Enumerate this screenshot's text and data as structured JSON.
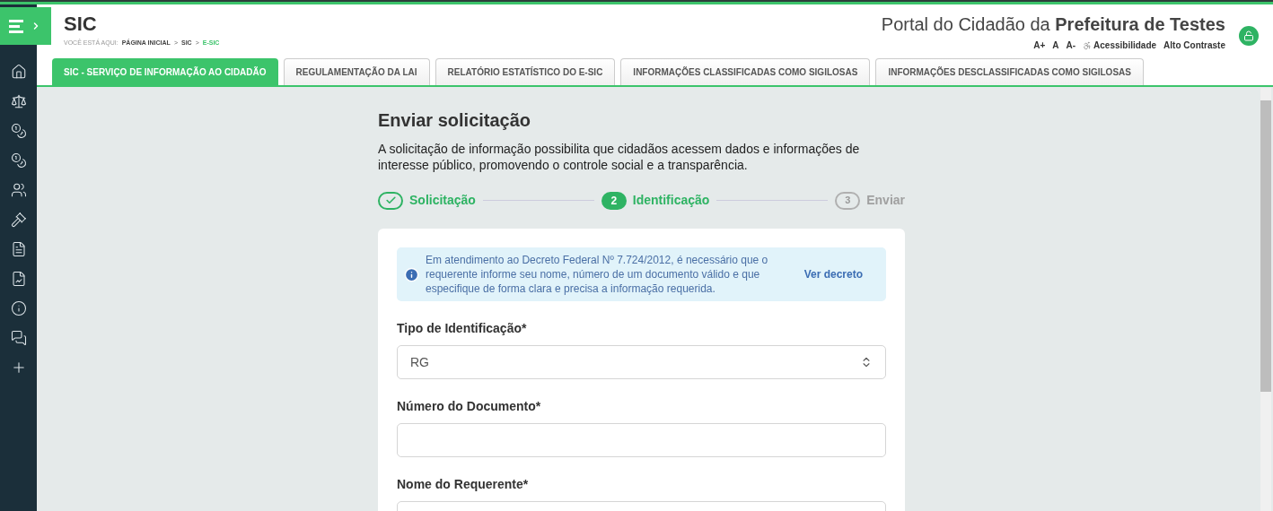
{
  "header": {
    "title": "SIC",
    "breadcrumb_label": "VOCÊ ESTÁ AQUI:",
    "breadcrumb": [
      {
        "label": "PÁGINA INICIAL",
        "selected": false
      },
      {
        "label": "SIC",
        "selected": false
      },
      {
        "label": "E-SIC",
        "selected": true
      }
    ],
    "breadcrumb_separator": ">",
    "portal_prefix": "Portal do Cidadão da",
    "portal_name": "Prefeitura de Testes",
    "accessibility": [
      "A+",
      "A",
      "A-"
    ],
    "accessibility_label": "Acessibilidade",
    "contrast_label": "Alto Contraste"
  },
  "tabs": [
    {
      "label": "SIC - SERVIÇO DE INFORMAÇÃO AO CIDADÃO",
      "selected": true
    },
    {
      "label": "REGULAMENTAÇÃO DA LAI",
      "selected": false
    },
    {
      "label": "RELATÓRIO ESTATÍSTICO DO E-SIC",
      "selected": false
    },
    {
      "label": "INFORMAÇÕES CLASSIFICADAS COMO SIGILOSAS",
      "selected": false
    },
    {
      "label": "INFORMAÇÕES DESCLASSIFICADAS COMO SIGILOSAS",
      "selected": false
    }
  ],
  "page": {
    "title": "Enviar solicitação",
    "description": "A solicitação de informação possibilita que cidadãos acessem dados e informações de interesse público, promovendo o controle social e a transparência."
  },
  "steps": [
    {
      "kind": "done",
      "label": "Solicitação"
    },
    {
      "kind": "current",
      "number": "2",
      "label": "Identificação"
    },
    {
      "kind": "pending",
      "number": "3",
      "label": "Enviar"
    }
  ],
  "notice": {
    "text": "Em atendimento ao Decreto Federal Nº 7.724/2012, é necessário que o requerente informe seu nome, número de um documento válido e que especifique de forma clara e precisa a informação requerida.",
    "link": "Ver decreto"
  },
  "fields": [
    {
      "kind": "select",
      "label": "Tipo de Identificação*",
      "value": "RG"
    },
    {
      "kind": "text",
      "label": "Número do Documento*"
    },
    {
      "kind": "text",
      "label": "Nome do Requerente*"
    }
  ]
}
